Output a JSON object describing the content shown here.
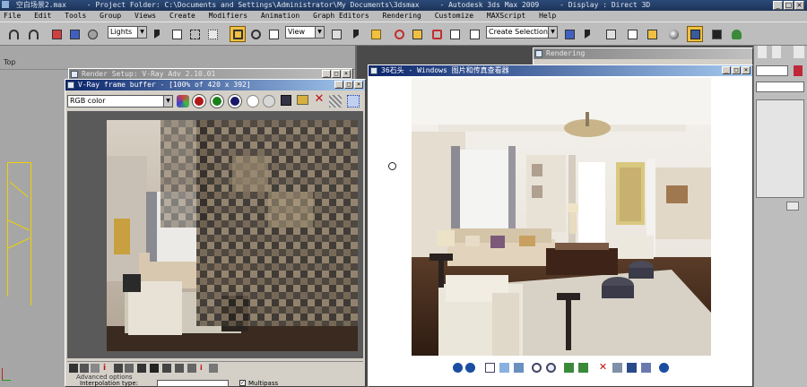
{
  "window": {
    "title": "空白场景2.max",
    "project": "- Project Folder: C:\\Documents and Settings\\Administrator\\My Documents\\3dsmax",
    "app": "- Autodesk 3ds Max 2009",
    "display": "- Display : Direct 3D"
  },
  "menu": [
    "File",
    "Edit",
    "Tools",
    "Group",
    "Views",
    "Create",
    "Modifiers",
    "Animation",
    "Graph Editors",
    "Rendering",
    "Customize",
    "MAXScript",
    "Help"
  ],
  "toolbar": {
    "filter": "Lights",
    "ref_coord": "View",
    "named_sel": "Create Selection Set"
  },
  "viewport": {
    "label": "Top"
  },
  "render_setup": {
    "title": "Render Setup: V-Ray Adv 2.10.01"
  },
  "vfb": {
    "title": "V-Ray frame buffer - [100% of 420 x 392]",
    "channel": "RGB color",
    "bottom_label": "Advanced options",
    "interp_label": "Interpolation type:",
    "multipass_label": "Multipass"
  },
  "rendering_panel": {
    "title": "Rendering"
  },
  "photo_viewer": {
    "title": "36石头 - Windows 图片和传真查看器"
  },
  "colors": {
    "accent": "#f0c040",
    "title_active": "#0a246a",
    "chip_red": "#c0283a"
  },
  "icons": {
    "vfb_tools": [
      "colors-icon",
      "red-channel-icon",
      "green-channel-icon",
      "blue-channel-icon",
      "alpha-icon",
      "mono-icon",
      "save-icon",
      "open-icon",
      "clear-icon",
      "track-icon",
      "region-icon"
    ],
    "photo_tools": [
      "prev-icon",
      "next-icon",
      "best-fit-icon",
      "actual-size-icon",
      "slideshow-icon",
      "zoom-in-icon",
      "zoom-out-icon",
      "rotate-cw-icon",
      "rotate-ccw-icon",
      "delete-icon",
      "print-icon",
      "save-icon",
      "edit-icon",
      "help-icon"
    ]
  }
}
